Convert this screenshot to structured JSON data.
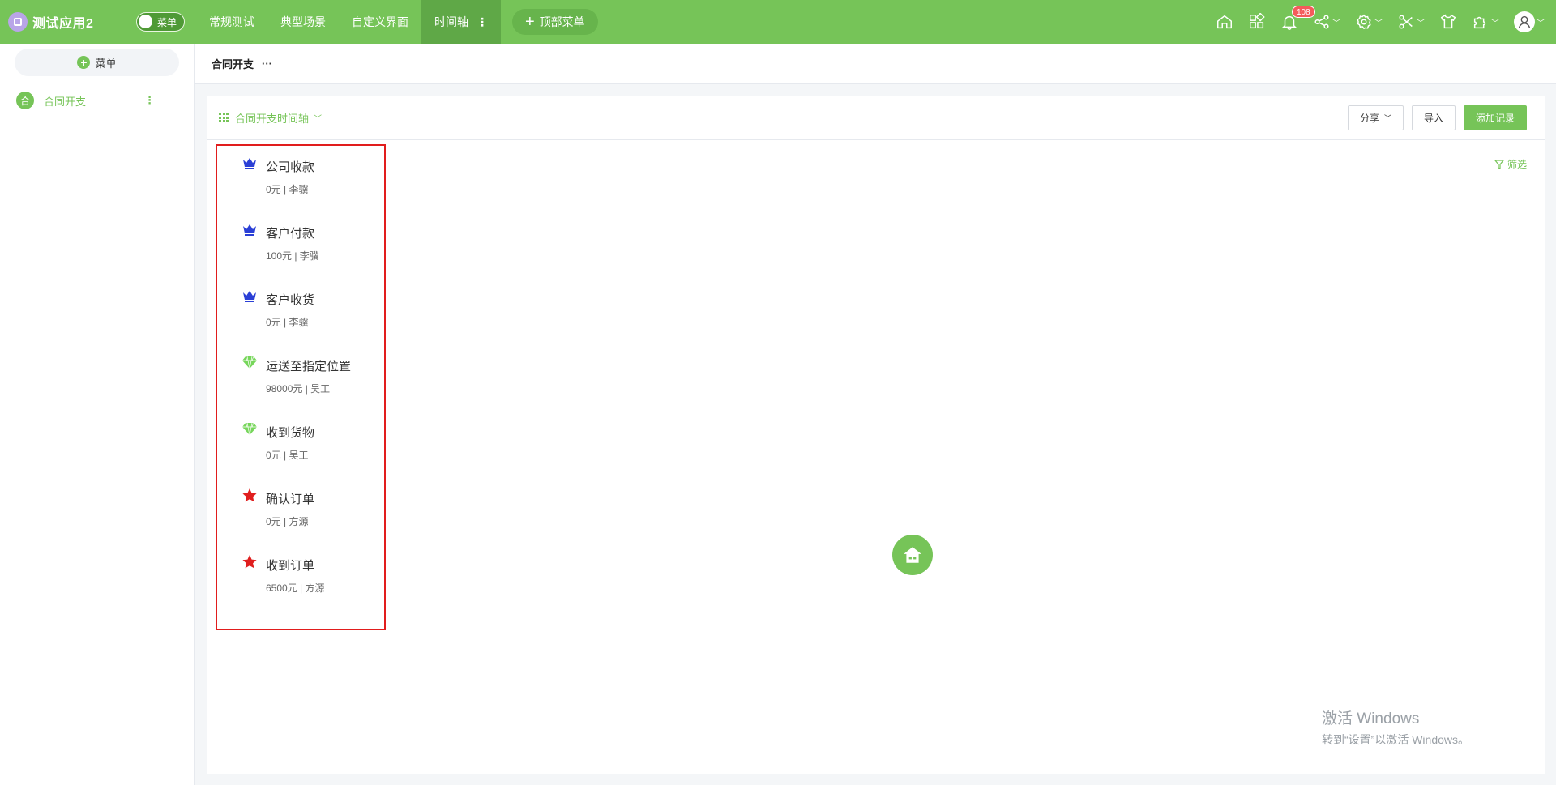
{
  "app": {
    "title": "测试应用2",
    "menu_toggle_label": "菜单"
  },
  "nav": {
    "items": [
      {
        "label": "常规测试"
      },
      {
        "label": "典型场景"
      },
      {
        "label": "自定义界面"
      },
      {
        "label": "时间轴"
      }
    ],
    "add_top_menu_label": "顶部菜单"
  },
  "top_icons": {
    "notification_count": "108"
  },
  "sidebar": {
    "menu_button_label": "菜单",
    "items": [
      {
        "icon_text": "合",
        "label": "合同开支"
      }
    ]
  },
  "main": {
    "title": "合同开支",
    "view_name": "合同开支时间轴",
    "actions": {
      "share_label": "分享",
      "import_label": "导入",
      "add_label": "添加记录"
    },
    "filter_label": "筛选"
  },
  "timeline": {
    "items": [
      {
        "title": "公司收款",
        "sub": "0元 | 李骥",
        "marker": "crown-icon",
        "color": "#2a3fd6"
      },
      {
        "title": "客户付款",
        "sub": "100元 | 李骥",
        "marker": "crown-icon",
        "color": "#2a3fd6"
      },
      {
        "title": "客户收货",
        "sub": "0元 | 李骥",
        "marker": "crown-icon",
        "color": "#2a3fd6"
      },
      {
        "title": "运送至指定位置",
        "sub": "98000元 | 吴工",
        "marker": "diamond-icon",
        "color": "#76d65a"
      },
      {
        "title": "收到货物",
        "sub": "0元 | 吴工",
        "marker": "diamond-icon",
        "color": "#76d65a"
      },
      {
        "title": "确认订单",
        "sub": "0元 | 方源",
        "marker": "star-icon",
        "color": "#e01e1e"
      },
      {
        "title": "收到订单",
        "sub": "6500元 | 方源",
        "marker": "star-icon",
        "color": "#e01e1e"
      }
    ]
  },
  "watermark": {
    "line1": "激活 Windows",
    "line2": "转到“设置”以激活 Windows。"
  },
  "colors": {
    "brand": "#76c458",
    "highlight": "#e11d1d"
  }
}
